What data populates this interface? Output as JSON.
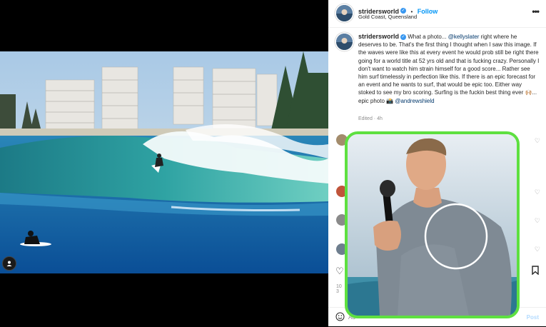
{
  "post": {
    "username": "stridersworld",
    "follow_label": "Follow",
    "dot": "•",
    "location": "Gold Coast, Queensland",
    "caption_pre": "What a photo... ",
    "mention_1": "@kellyslater",
    "caption_main": " right where he deserves to be. That's the first thing I thought when I saw this image. If the waves were like this at every event he would prob still be right there going for a world title at 52 yrs old and that is fucking crazy. Personally I don't want to watch him strain himself for a good score... Rather see him surf timelessly in perfection like this. If there is an epic forecast for an event and he wants to surf, that would be epic too. Either way stoked to see my bro scoring. Surfing is the fuckin best thing ever 🙌🏼... epic photo 📸 ",
    "mention_2": "@andrewshield",
    "edited": "Edited",
    "time": "4h",
    "likes_partial": "10",
    "likes_partial_2": "3",
    "add_comment_placeholder": "Ad",
    "post_label": "Post"
  },
  "colors": {
    "overlay_border": "#5ee040",
    "link_blue": "#0095f6",
    "verified_blue": "#3897f0"
  },
  "icons": [
    "more-options-icon",
    "verified-badge-icon",
    "user-tag-icon",
    "heart-icon",
    "bookmark-icon",
    "emoji-icon"
  ]
}
